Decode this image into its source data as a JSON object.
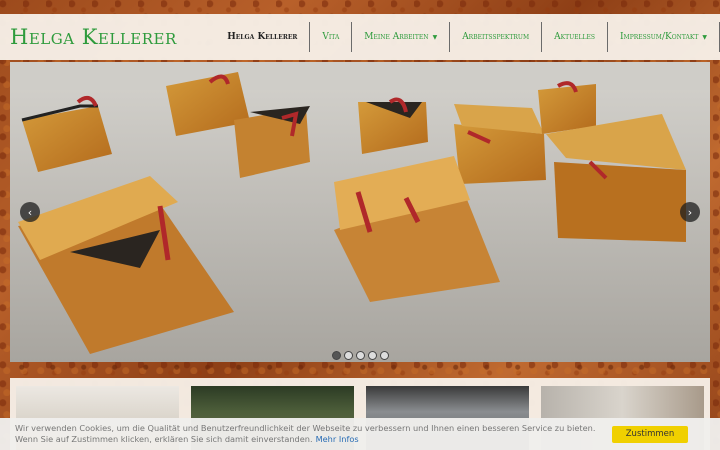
{
  "site": {
    "logo": "Helga Kellerer"
  },
  "nav": {
    "items": [
      {
        "label": "Helga Kellerer",
        "active": true,
        "dropdown": false
      },
      {
        "label": "Vita",
        "active": false,
        "dropdown": false
      },
      {
        "label": "Meine Arbeiten",
        "active": false,
        "dropdown": true
      },
      {
        "label": "Arbeitsspektrum",
        "active": false,
        "dropdown": false
      },
      {
        "label": "Aktuelles",
        "active": false,
        "dropdown": false
      },
      {
        "label": "Impressum/Kontakt",
        "active": false,
        "dropdown": true
      }
    ]
  },
  "slider": {
    "prev_icon": "‹",
    "next_icon": "›",
    "slide_count": 5,
    "active_slide": 1
  },
  "cookie": {
    "text": "Wir verwenden Cookies, um die Qualität und Benutzerfreundlichkeit der Webseite zu verbessern und Ihnen einen besseren Service zu bieten. Wenn Sie auf Zustimmen klicken, erklären Sie sich damit einverstanden.",
    "more_label": "Mehr Infos",
    "accept_label": "Zustimmen"
  },
  "colors": {
    "brand_green": "#2e9b3c",
    "accept_yellow": "#f0d000",
    "link_blue": "#2a6db5"
  }
}
